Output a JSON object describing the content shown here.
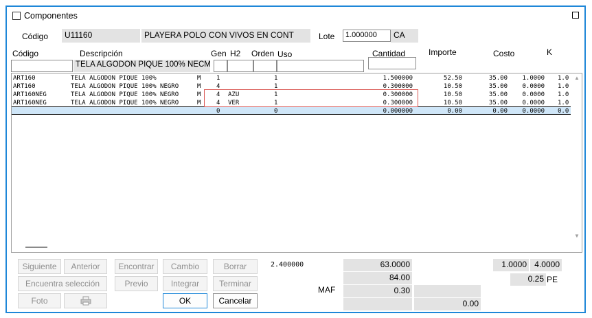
{
  "window": {
    "title": "Componentes"
  },
  "header": {
    "codigo_label": "Código",
    "codigo_value": "U11160",
    "descripcion_value": "PLAYERA POLO CON VIVOS EN CONT",
    "lote_label": "Lote",
    "lote_value": "1.000000",
    "unit_value": "CA"
  },
  "columns": {
    "codigo": "Código",
    "descripcion": "Descripción",
    "gen": "Gen",
    "h2": "H2",
    "orden": "Orden",
    "uso": "Uso",
    "cantidad": "Cantidad",
    "importe": "Importe",
    "costo": "Costo",
    "k": "K"
  },
  "filters": {
    "descripcion": "TELA ALGODON PIQUE 100% NEC",
    "gen": "M"
  },
  "rows": [
    {
      "codigo": "ART160",
      "desc": "TELA ALGODON PIQUE 100%",
      "m": "M",
      "gen": "1",
      "h2": "",
      "orden": "1",
      "cantidad": "1.500000",
      "importe": "52.50",
      "costo": "35.00",
      "f1": "1.0000",
      "k": "1.0"
    },
    {
      "codigo": "ART160",
      "desc": "TELA ALGODON PIQUE 100% NEGRO",
      "m": "M",
      "gen": "4",
      "h2": "",
      "orden": "1",
      "cantidad": "0.300000",
      "importe": "10.50",
      "costo": "35.00",
      "f1": "0.0000",
      "k": "1.0"
    },
    {
      "codigo": "ART160NEG",
      "desc": "TELA ALGODON PIQUE 100% NEGRO",
      "m": "M",
      "gen": "4",
      "h2": "AZU",
      "orden": "1",
      "cantidad": "0.300000",
      "importe": "10.50",
      "costo": "35.00",
      "f1": "0.0000",
      "k": "1.0"
    },
    {
      "codigo": "ART160NEG",
      "desc": "TELA ALGODON PIQUE 100% NEGRO",
      "m": "M",
      "gen": "4",
      "h2": "VER",
      "orden": "1",
      "cantidad": "0.300000",
      "importe": "10.50",
      "costo": "35.00",
      "f1": "0.0000",
      "k": "1.0"
    },
    {
      "codigo": "",
      "desc": "",
      "m": "",
      "gen": "0",
      "h2": "",
      "orden": "0",
      "cantidad": "0.000000",
      "importe": "0.00",
      "costo": "0.00",
      "f1": "0.0000",
      "k": "0.0"
    }
  ],
  "buttons": {
    "siguiente": "Siguiente",
    "anterior": "Anterior",
    "encontrar": "Encontrar",
    "cambio": "Cambio",
    "borrar": "Borrar",
    "encuentra_seleccion": "Encuentra selección",
    "previo": "Previo",
    "integrar": "Integrar",
    "terminar": "Terminar",
    "foto": "Foto",
    "ok": "OK",
    "cancelar": "Cancelar"
  },
  "totals": {
    "left_value": "2.400000",
    "importe_total": "63.0000",
    "v84": "84.00",
    "maf_label": "MAF",
    "maf_value": "0.30",
    "bottom_value": "0.00",
    "r1": "1.0000",
    "r2": "4.0000",
    "r3": "0.25",
    "pe_label": "PE"
  }
}
